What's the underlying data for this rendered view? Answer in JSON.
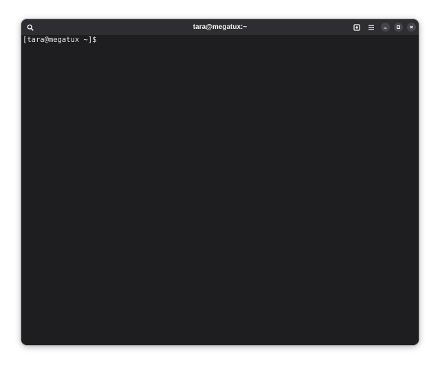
{
  "window": {
    "title": "tara@megatux:~"
  },
  "headerbar": {
    "buttons": [
      {
        "icon": "search-icon"
      },
      {
        "icon": "new-tab-icon"
      },
      {
        "icon": "hamburger-menu-icon"
      },
      {
        "icon": "minimize-icon"
      },
      {
        "icon": "maximize-icon"
      },
      {
        "icon": "close-icon"
      }
    ]
  },
  "terminal": {
    "prompt": "[tara@megatux ~]$"
  },
  "colors": {
    "headerbar_bg": "#2e2e32",
    "terminal_bg": "#1e1e20",
    "text": "#e4e4e4",
    "window_control_bg": "#45454a"
  }
}
